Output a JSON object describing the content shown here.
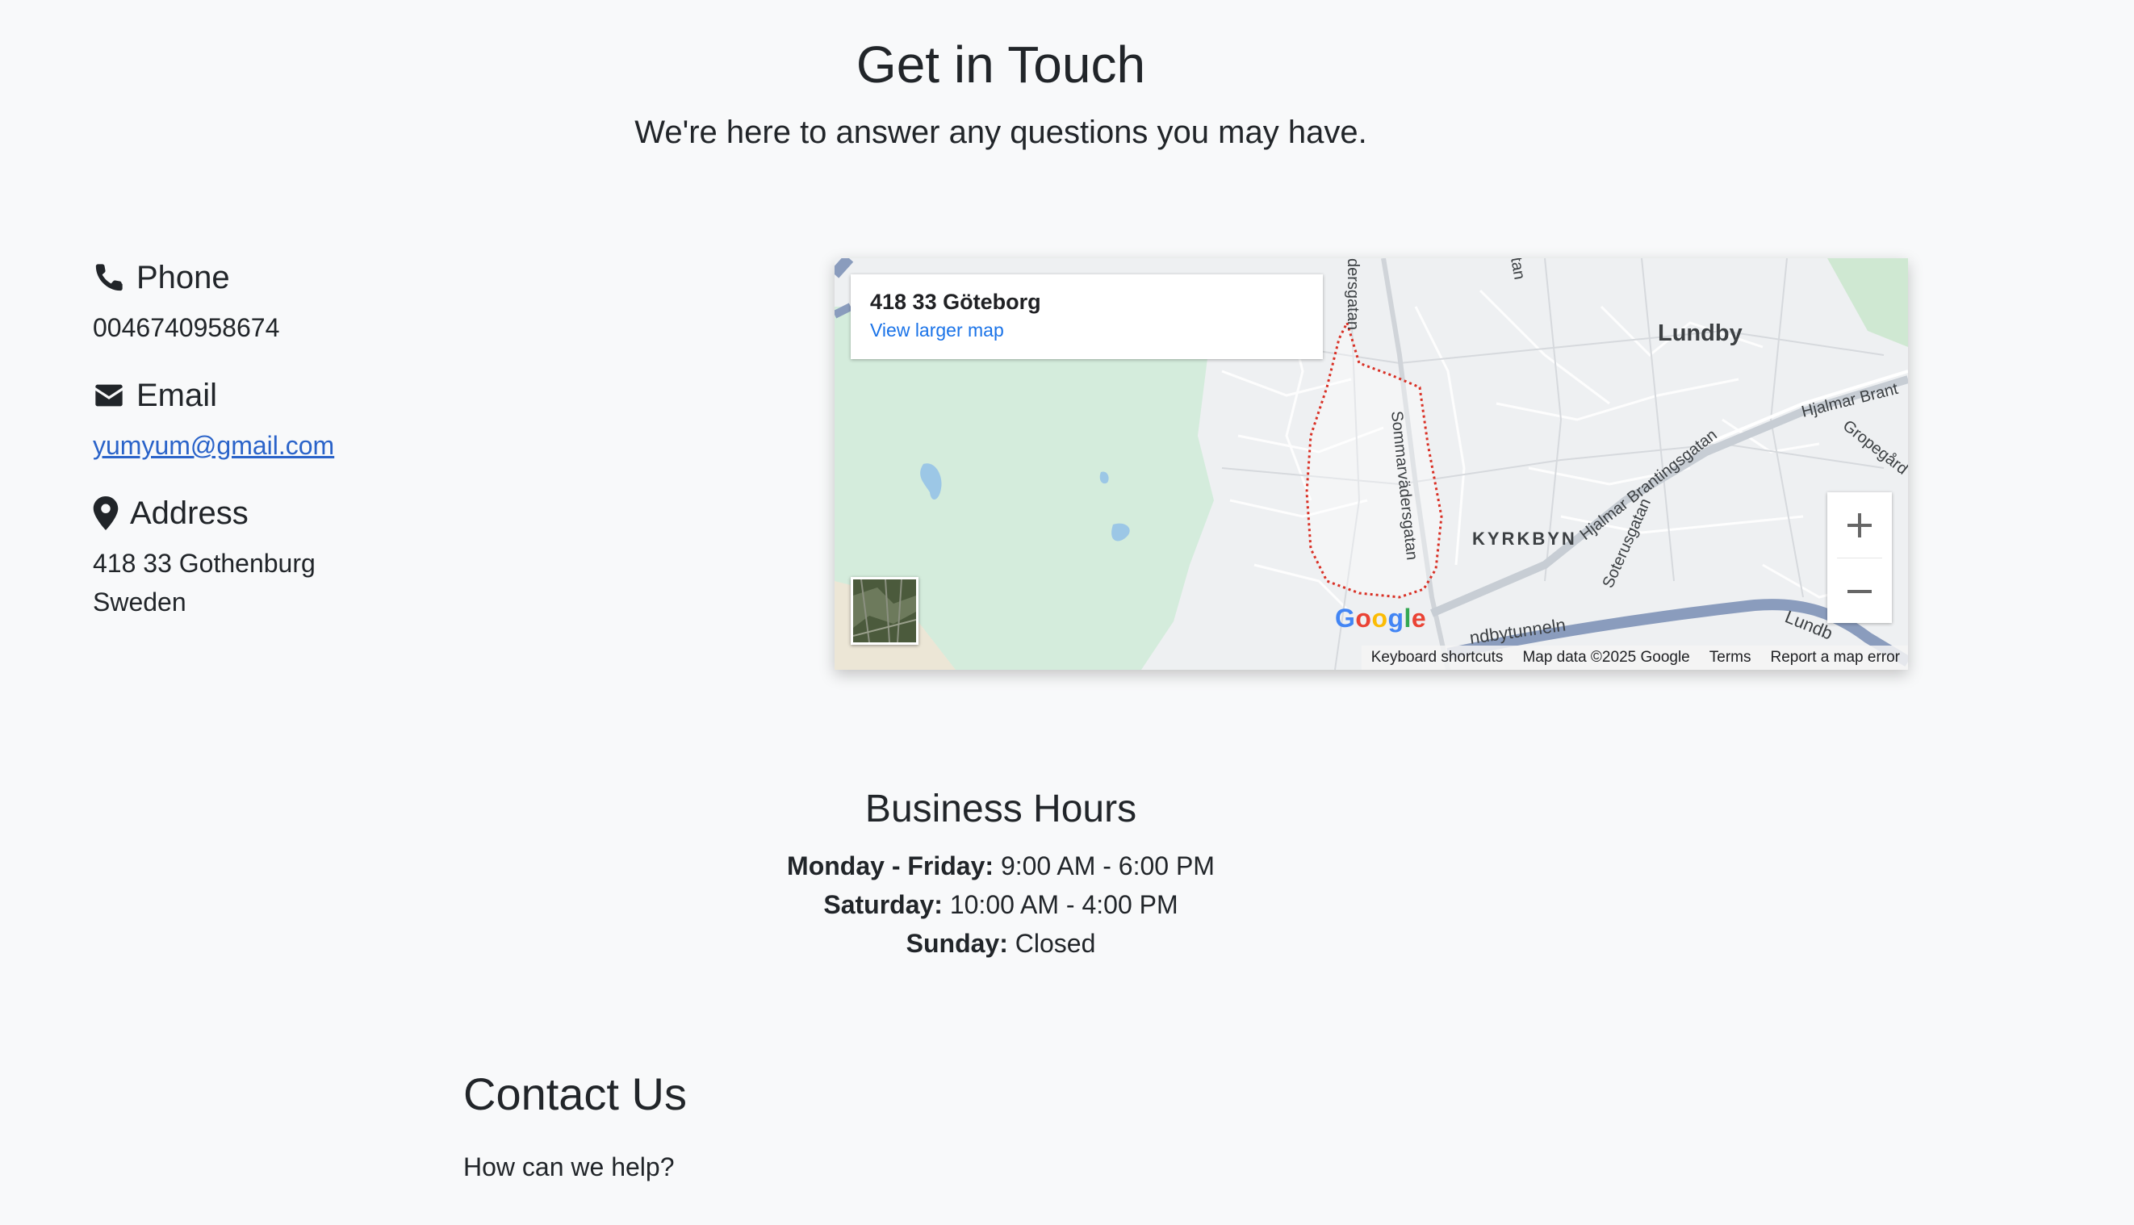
{
  "header": {
    "title": "Get in Touch",
    "subtitle": "We're here to answer any questions you may have."
  },
  "contact_info": {
    "phone": {
      "icon": "phone-icon",
      "label": "Phone",
      "value": "0046740958674"
    },
    "email": {
      "icon": "envelope-icon",
      "label": "Email",
      "value": "yumyum@gmail.com"
    },
    "address": {
      "icon": "map-marker-icon",
      "label": "Address",
      "line1": "418 33 Gothenburg",
      "line2": "Sweden"
    }
  },
  "map": {
    "place_title": "418 33 Göteborg",
    "larger_map_link": "View larger map",
    "labels": {
      "lundby": "Lundby",
      "kyrkbyn": "KYRKBYN",
      "street_1": "dersgatan",
      "street_2": "tan",
      "street_3": "Sommarvädersgatan",
      "street_4": "Hjalmar Brantingsgatan",
      "street_5": "Hjalmar Brant",
      "street_6": "Gropegård",
      "street_7": "Soterusgatan",
      "street_8": "ndbytunneln",
      "street_9": "Lundb"
    },
    "zoom_in": "+",
    "zoom_out": "−",
    "logo": "Google",
    "footer": {
      "keyboard": "Keyboard shortcuts",
      "map_data": "Map data ©2025 Google",
      "terms": "Terms",
      "report": "Report a map error"
    }
  },
  "hours": {
    "title": "Business Hours",
    "rows": [
      {
        "day": "Monday - Friday:",
        "time": "9:00 AM - 6:00 PM"
      },
      {
        "day": "Saturday:",
        "time": "10:00 AM - 4:00 PM"
      },
      {
        "day": "Sunday:",
        "time": "Closed"
      }
    ]
  },
  "contact_form": {
    "title": "Contact Us",
    "prompt": "How can we help?"
  },
  "colors": {
    "link": "#2a63c9",
    "text": "#212529",
    "background": "#f8f9fa",
    "map_park": "#d4ecdc",
    "map_boundary": "#d93025"
  }
}
